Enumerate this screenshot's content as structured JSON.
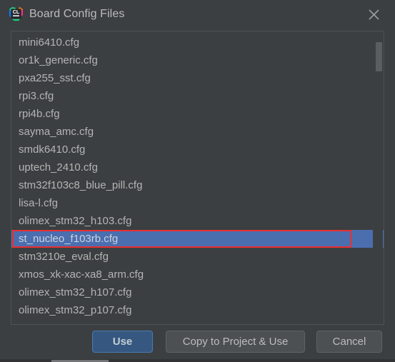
{
  "window": {
    "title": "Board Config Files",
    "app_icon": "clion-logo-icon",
    "close_icon": "close-icon"
  },
  "list": {
    "name": "board-config-file-list",
    "selected_index": 11,
    "items": [
      "mini6410.cfg",
      "or1k_generic.cfg",
      "pxa255_sst.cfg",
      "rpi3.cfg",
      "rpi4b.cfg",
      "sayma_amc.cfg",
      "smdk6410.cfg",
      "uptech_2410.cfg",
      "stm32f103c8_blue_pill.cfg",
      "lisa-l.cfg",
      "olimex_stm32_h103.cfg",
      "st_nucleo_f103rb.cfg",
      "stm3210e_eval.cfg",
      "xmos_xk-xac-xa8_arm.cfg",
      "olimex_stm32_h107.cfg",
      "olimex_stm32_p107.cfg"
    ]
  },
  "scrollbar": {
    "name": "list-scrollbar",
    "thumb_position": "top"
  },
  "annotation": {
    "target": "st_nucleo_f103rb.cfg",
    "color": "#e83030"
  },
  "buttons": {
    "use": "Use",
    "copy_to_project_and_use": "Copy to Project & Use",
    "cancel": "Cancel"
  },
  "colors": {
    "dialog_background": "#3c3f41",
    "selection_blue": "#4b6eaf",
    "primary_button": "#365880",
    "text": "#b4b4b4",
    "annotation_red": "#e83030"
  }
}
